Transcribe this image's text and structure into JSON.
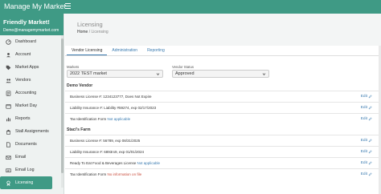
{
  "app": {
    "title": "Manage My Market"
  },
  "sidebar": {
    "market_name": "Friendly Market!",
    "user_email": "Demo@managemymarket.com",
    "items": [
      {
        "label": "Dashboard",
        "icon": "dashboard-icon"
      },
      {
        "label": "Account",
        "icon": "user-icon"
      },
      {
        "label": "Market Apps",
        "icon": "tag-icon"
      },
      {
        "label": "Vendors",
        "icon": "vendors-icon"
      },
      {
        "label": "Accounting",
        "icon": "accounting-icon"
      },
      {
        "label": "Market Day",
        "icon": "calendar-icon"
      },
      {
        "label": "Reports",
        "icon": "chart-icon"
      },
      {
        "label": "Stall Assignments",
        "icon": "stall-icon"
      },
      {
        "label": "Documents",
        "icon": "document-icon"
      },
      {
        "label": "Email",
        "icon": "email-icon"
      },
      {
        "label": "Email Log",
        "icon": "email-log-icon"
      },
      {
        "label": "Licensing",
        "icon": "licensing-icon"
      }
    ]
  },
  "page": {
    "title": "Licensing",
    "breadcrumb": {
      "home": "Home",
      "separator": "/",
      "current": "Licensing"
    }
  },
  "tabs": [
    {
      "label": "Vendor Licensing",
      "active": true
    },
    {
      "label": "Administration",
      "active": false
    },
    {
      "label": "Reporting",
      "active": false
    }
  ],
  "filters": {
    "markets_label": "Markets",
    "markets_value": "2022 TEST market",
    "status_label": "Vendor Status",
    "status_value": "Approved"
  },
  "groups": [
    {
      "name": "Demo Vendor",
      "rows": [
        {
          "text": "Business License #: 1234123777, Does Not Expire",
          "extra": "",
          "extra_style": ""
        },
        {
          "text": "Liability Insurance #: Liability #59274, exp 02/17/2023",
          "extra": "",
          "extra_style": ""
        },
        {
          "text": "Tax Identification Form",
          "extra": "Not applicable",
          "extra_style": "link"
        }
      ]
    },
    {
      "name": "Staci's Farm",
      "rows": [
        {
          "text": "Business License #: 56789, exp 08/31/2025",
          "extra": "",
          "extra_style": ""
        },
        {
          "text": "Liability Insurance #: 6893rx9, exp 01/01/2024",
          "extra": "",
          "extra_style": ""
        },
        {
          "text": "Ready To Eat Food & Beverages License",
          "extra": "Not applicable",
          "extra_style": "link"
        },
        {
          "text": "Tax Identification Form",
          "extra": "No information on file",
          "extra_style": "warn"
        }
      ]
    }
  ],
  "edit_label": "Edit",
  "colors": {
    "brand": "#3f9a85",
    "link": "#3a7bb0",
    "warning": "#c94a3a"
  }
}
